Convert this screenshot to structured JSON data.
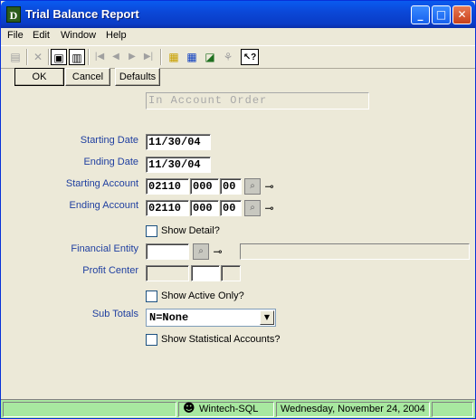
{
  "window": {
    "title": "Trial Balance Report",
    "icon_letter": "D",
    "controls": {
      "minimize": "_",
      "maximize": "□",
      "close": "✕"
    }
  },
  "menu": {
    "items": [
      "File",
      "Edit",
      "Window",
      "Help"
    ]
  },
  "toolbar": {
    "icons": [
      "new-icon",
      "delete-icon",
      "save-icon",
      "trash-icon",
      "first-record-icon",
      "previous-record-icon",
      "next-record-icon",
      "last-record-icon",
      "notes-icon",
      "calculator-icon",
      "report-icon",
      "users-icon",
      "help-icon"
    ],
    "glyphs": {
      "new": "▤",
      "delete": "✕",
      "save": "▣",
      "trash": "▥",
      "first": "|◀",
      "prev": "◀",
      "next": "▶",
      "last": "▶|",
      "notes": "▦",
      "calc": "▦",
      "report": "◪",
      "users": "⚘",
      "help": "↖?"
    }
  },
  "actions": {
    "ok": "OK",
    "cancel": "Cancel",
    "defaults": "Defaults"
  },
  "form": {
    "order_display": "In Account Order",
    "starting_date": {
      "label": "Starting Date",
      "value": "11/30/04"
    },
    "ending_date": {
      "label": "Ending Date",
      "value": "11/30/04"
    },
    "starting_account": {
      "label": "Starting Account",
      "segments": [
        "02110",
        "000",
        "00"
      ]
    },
    "ending_account": {
      "label": "Ending Account",
      "segments": [
        "02110",
        "000",
        "00"
      ]
    },
    "show_detail": {
      "label": "Show Detail?",
      "checked": false
    },
    "financial_entity": {
      "label": "Financial Entity",
      "value": "",
      "description": ""
    },
    "profit_center": {
      "label": "Profit Center",
      "segments": [
        "",
        "",
        ""
      ]
    },
    "show_active_only": {
      "label": "Show Active Only?",
      "checked": false
    },
    "sub_totals": {
      "label": "Sub Totals",
      "selected": "N=None"
    },
    "show_statistical": {
      "label": "Show Statistical Accounts?",
      "checked": false
    },
    "lookup_glyphs": {
      "binoculars": "⌕",
      "pin": "⊸"
    }
  },
  "status": {
    "left": "",
    "server": "Wintech-SQL",
    "server_icon_glyph": "☻",
    "date": "Wednesday, November 24, 2004",
    "right": ""
  },
  "colors": {
    "title_bar": "#0b48d8",
    "status_bar": "#a8e8a0",
    "label_blue": "#1f3fa0",
    "face": "#ece9d8"
  }
}
